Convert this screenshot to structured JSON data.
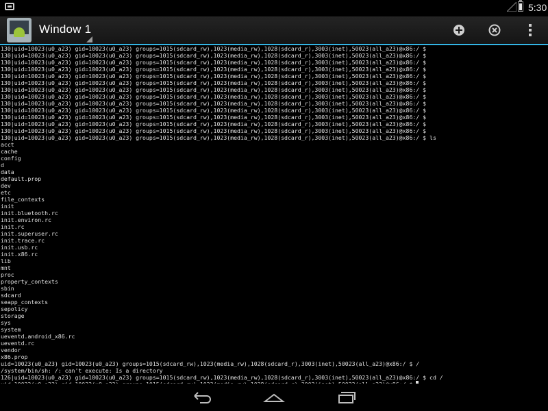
{
  "status_bar": {
    "time": "5:30",
    "icons": [
      "notification-icon",
      "signal-icon",
      "battery-icon"
    ]
  },
  "action_bar": {
    "title": "Window 1",
    "actions": [
      "add-icon",
      "close-window-icon",
      "overflow-menu-icon"
    ],
    "accent_color": "#33b5e5"
  },
  "terminal": {
    "lines": [
      "130|uid=10023(u0_a23) gid=10023(u0_a23) groups=1015(sdcard_rw),1023(media_rw),1028(sdcard_r),3003(inet),50023(all_a23)@x86:/ $",
      "130|uid=10023(u0_a23) gid=10023(u0_a23) groups=1015(sdcard_rw),1023(media_rw),1028(sdcard_r),3003(inet),50023(all_a23)@x86:/ $",
      "130|uid=10023(u0_a23) gid=10023(u0_a23) groups=1015(sdcard_rw),1023(media_rw),1028(sdcard_r),3003(inet),50023(all_a23)@x86:/ $",
      "130|uid=10023(u0_a23) gid=10023(u0_a23) groups=1015(sdcard_rw),1023(media_rw),1028(sdcard_r),3003(inet),50023(all_a23)@x86:/ $",
      "130|uid=10023(u0_a23) gid=10023(u0_a23) groups=1015(sdcard_rw),1023(media_rw),1028(sdcard_r),3003(inet),50023(all_a23)@x86:/ $",
      "130|uid=10023(u0_a23) gid=10023(u0_a23) groups=1015(sdcard_rw),1023(media_rw),1028(sdcard_r),3003(inet),50023(all_a23)@x86:/ $",
      "130|uid=10023(u0_a23) gid=10023(u0_a23) groups=1015(sdcard_rw),1023(media_rw),1028(sdcard_r),3003(inet),50023(all_a23)@x86:/ $",
      "130|uid=10023(u0_a23) gid=10023(u0_a23) groups=1015(sdcard_rw),1023(media_rw),1028(sdcard_r),3003(inet),50023(all_a23)@x86:/ $",
      "130|uid=10023(u0_a23) gid=10023(u0_a23) groups=1015(sdcard_rw),1023(media_rw),1028(sdcard_r),3003(inet),50023(all_a23)@x86:/ $",
      "130|uid=10023(u0_a23) gid=10023(u0_a23) groups=1015(sdcard_rw),1023(media_rw),1028(sdcard_r),3003(inet),50023(all_a23)@x86:/ $",
      "130|uid=10023(u0_a23) gid=10023(u0_a23) groups=1015(sdcard_rw),1023(media_rw),1028(sdcard_r),3003(inet),50023(all_a23)@x86:/ $",
      "130|uid=10023(u0_a23) gid=10023(u0_a23) groups=1015(sdcard_rw),1023(media_rw),1028(sdcard_r),3003(inet),50023(all_a23)@x86:/ $",
      "130|uid=10023(u0_a23) gid=10023(u0_a23) groups=1015(sdcard_rw),1023(media_rw),1028(sdcard_r),3003(inet),50023(all_a23)@x86:/ $",
      "130|uid=10023(u0_a23) gid=10023(u0_a23) groups=1015(sdcard_rw),1023(media_rw),1028(sdcard_r),3003(inet),50023(all_a23)@x86:/ $ ls",
      "acct",
      "cache",
      "config",
      "d",
      "data",
      "default.prop",
      "dev",
      "etc",
      "file_contexts",
      "init",
      "init.bluetooth.rc",
      "init.environ.rc",
      "init.rc",
      "init.superuser.rc",
      "init.trace.rc",
      "init.usb.rc",
      "init.x86.rc",
      "lib",
      "mnt",
      "proc",
      "property_contexts",
      "sbin",
      "sdcard",
      "seapp_contexts",
      "sepolicy",
      "storage",
      "sys",
      "system",
      "ueventd.android_x86.rc",
      "ueventd.rc",
      "vendor",
      "x86.prop",
      "uid=10023(u0_a23) gid=10023(u0_a23) groups=1015(sdcard_rw),1023(media_rw),1028(sdcard_r),3003(inet),50023(all_a23)@x86:/ $ /",
      "/system/bin/sh: /: can't execute: Is a directory",
      "126|uid=10023(u0_a23) gid=10023(u0_a23) groups=1015(sdcard_rw),1023(media_rw),1028(sdcard_r),3003(inet),50023(all_a23)@x86:/ $ cd /",
      "uid=10023(u0_a23) gid=10023(u0_a23) groups=1015(sdcard_rw),1023(media_rw),1028(sdcard_r),3003(inet),50023(all_a23)@x86:/ $ "
    ]
  },
  "nav_bar": {
    "buttons": [
      "back-icon",
      "home-icon",
      "recent-apps-icon"
    ]
  }
}
